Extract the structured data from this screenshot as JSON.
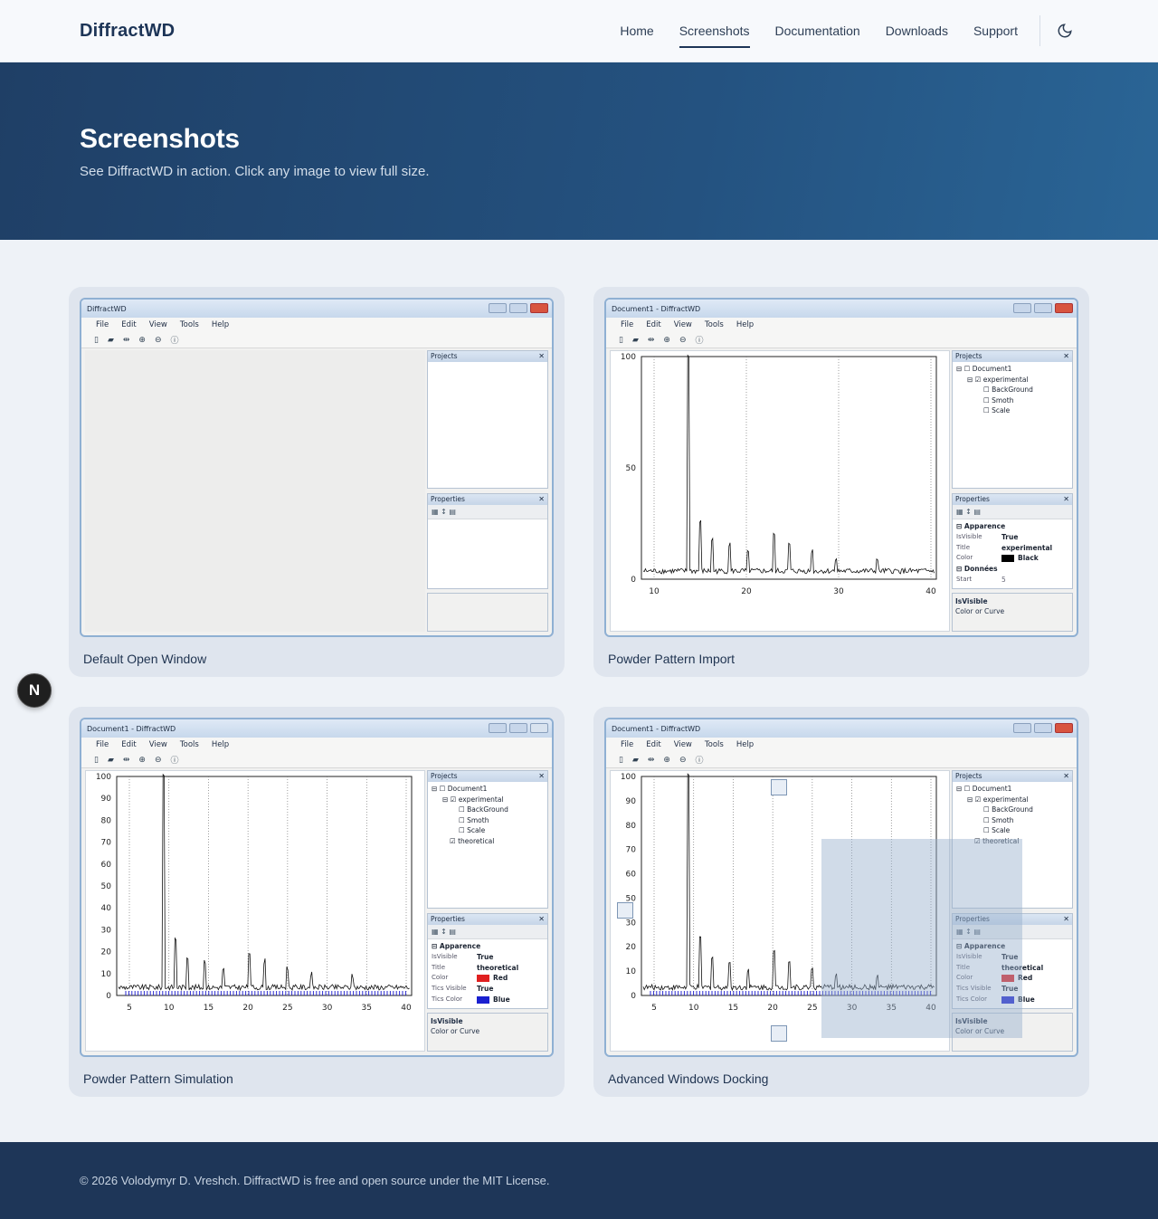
{
  "header": {
    "brand": "DiffractWD",
    "nav": [
      "Home",
      "Screenshots",
      "Documentation",
      "Downloads",
      "Support"
    ],
    "active_nav": "Screenshots",
    "theme_icon": "moon-icon"
  },
  "hero": {
    "title": "Screenshots",
    "subtitle": "See DiffractWD in action. Click any image to view full size."
  },
  "cards": [
    {
      "caption": "Default Open Window",
      "window_title": "DiffractWD",
      "menu": [
        "File",
        "Edit",
        "View",
        "Tools",
        "Help"
      ],
      "projects_label": "Projects",
      "properties_label": "Properties"
    },
    {
      "caption": "Powder Pattern Import",
      "window_title": "Document1 - DiffractWD",
      "menu": [
        "File",
        "Edit",
        "View",
        "Tools",
        "Help"
      ],
      "projects_label": "Projects",
      "properties_label": "Properties",
      "tree": [
        "Document1",
        "experimental",
        "BackGround",
        "Smoth",
        "Scale"
      ],
      "props": {
        "section1": "Apparence",
        "rows": [
          [
            "IsVisible",
            "True"
          ],
          [
            "Title",
            "experimental"
          ],
          [
            "Color",
            "Black"
          ]
        ],
        "section2": "Données",
        "start_k": "Start",
        "start_v": "5"
      },
      "desc_title": "IsVisible",
      "desc_text": "Color or Curve",
      "y_ticks": [
        "100",
        "50",
        "0"
      ],
      "x_ticks": [
        "10",
        "20",
        "30",
        "40"
      ]
    },
    {
      "caption": "Powder Pattern Simulation",
      "window_title": "Document1 - DiffractWD",
      "menu": [
        "File",
        "Edit",
        "View",
        "Tools",
        "Help"
      ],
      "projects_label": "Projects",
      "properties_label": "Properties",
      "tree": [
        "Document1",
        "experimental",
        "BackGround",
        "Smoth",
        "Scale",
        "theoretical"
      ],
      "props": {
        "section1": "Apparence",
        "rows": [
          [
            "IsVisible",
            "True"
          ],
          [
            "Title",
            "theoretical"
          ],
          [
            "Color",
            "Red"
          ],
          [
            "Tics Visible",
            "True"
          ],
          [
            "Tics Color",
            "Blue"
          ]
        ]
      },
      "desc_title": "IsVisible",
      "desc_text": "Color or Curve",
      "y_ticks": [
        "100",
        "90",
        "80",
        "70",
        "60",
        "50",
        "40",
        "30",
        "20",
        "10",
        "0"
      ],
      "x_ticks": [
        "5",
        "10",
        "15",
        "20",
        "25",
        "30",
        "35",
        "40"
      ]
    },
    {
      "caption": "Advanced Windows Docking",
      "window_title": "Document1 - DiffractWD",
      "menu": [
        "File",
        "Edit",
        "View",
        "Tools",
        "Help"
      ],
      "projects_label": "Projects",
      "properties_label": "Properties",
      "tree": [
        "Document1",
        "experimental",
        "BackGround",
        "Smoth",
        "Scale",
        "theoretical"
      ],
      "props": {
        "section1": "Apparence",
        "rows": [
          [
            "IsVisible",
            "True"
          ],
          [
            "Title",
            "theoretical"
          ],
          [
            "Color",
            "Red"
          ],
          [
            "Tics Visible",
            "True"
          ],
          [
            "Tics Color",
            "Blue"
          ]
        ]
      },
      "desc_title": "IsVisible",
      "desc_text": "Color or Curve",
      "y_ticks": [
        "100",
        "90",
        "80",
        "70",
        "60",
        "50",
        "30",
        "20",
        "10",
        "0"
      ],
      "x_ticks": [
        "5",
        "10",
        "15",
        "20",
        "25",
        "30",
        "35",
        "40"
      ]
    }
  ],
  "badge": "N",
  "footer": {
    "text": "© 2026 Volodymyr D. Vreshch. DiffractWD is free and open source under the MIT License."
  },
  "colors": {
    "hero_start": "#1f3f66",
    "hero_end": "#2a6596",
    "footer_bg": "#1e3658",
    "red_swatch": "#e02020",
    "blue_swatch": "#1a20d0",
    "black_swatch": "#000000"
  }
}
